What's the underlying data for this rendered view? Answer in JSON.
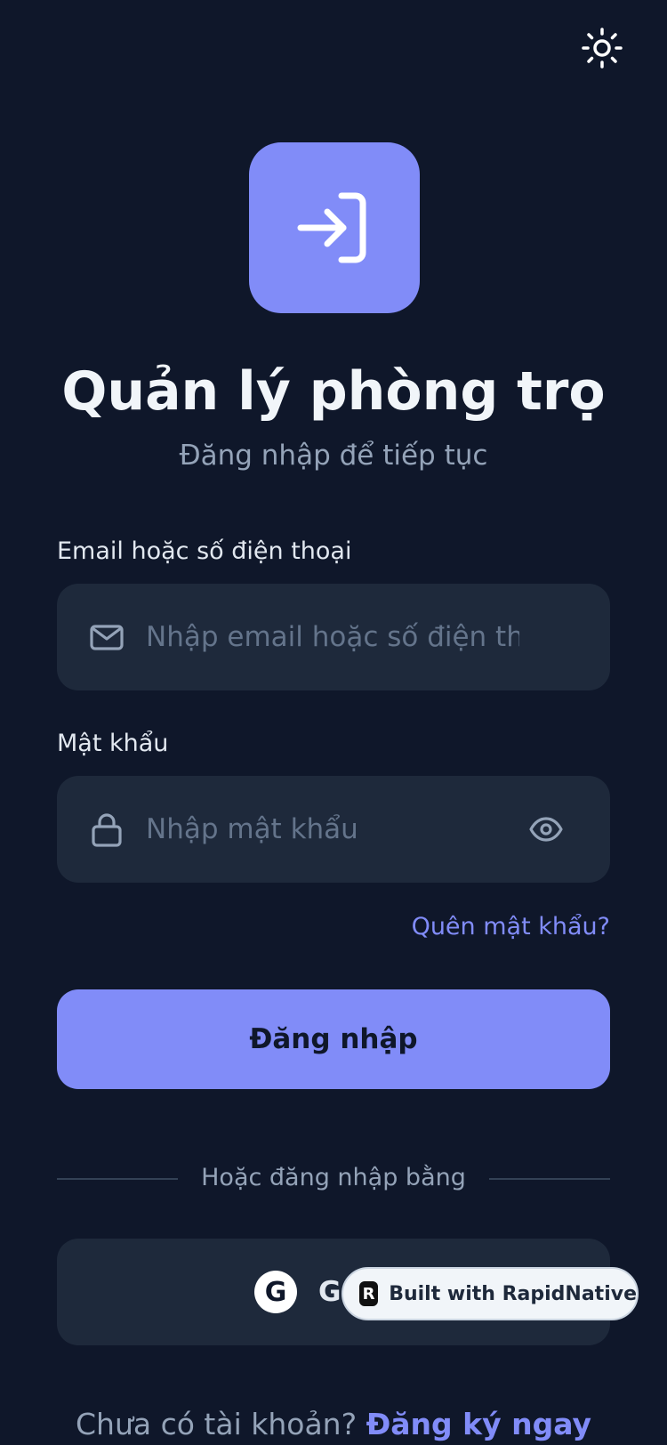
{
  "header": {
    "theme_toggle_icon": "sun-icon"
  },
  "logo": {
    "icon": "login-arrow-icon",
    "background_color": "#818cf8"
  },
  "app": {
    "title": "Quản lý phòng trọ",
    "subtitle": "Đăng nhập để tiếp tục"
  },
  "form": {
    "email": {
      "label": "Email hoặc số điện thoại",
      "placeholder": "Nhập email hoặc số điện thoại",
      "value": "",
      "icon": "mail-icon"
    },
    "password": {
      "label": "Mật khẩu",
      "placeholder": "Nhập mật khẩu",
      "value": "",
      "icon": "lock-icon",
      "toggle_icon": "eye-icon"
    },
    "forgot_password": "Quên mật khẩu?",
    "submit_label": "Đăng nhập"
  },
  "social": {
    "divider_text": "Hoặc đăng nhập bằng",
    "google_icon_letter": "G",
    "google_label_visible": "G"
  },
  "badge": {
    "logo_letter": "R",
    "label": "Built with RapidNative"
  },
  "footer": {
    "prompt": "Chưa có tài khoản?",
    "signup_link": "Đăng ký ngay"
  },
  "colors": {
    "background": "#0f172a",
    "surface": "#1e293b",
    "accent": "#818cf8",
    "muted_text": "#94a3b8"
  }
}
